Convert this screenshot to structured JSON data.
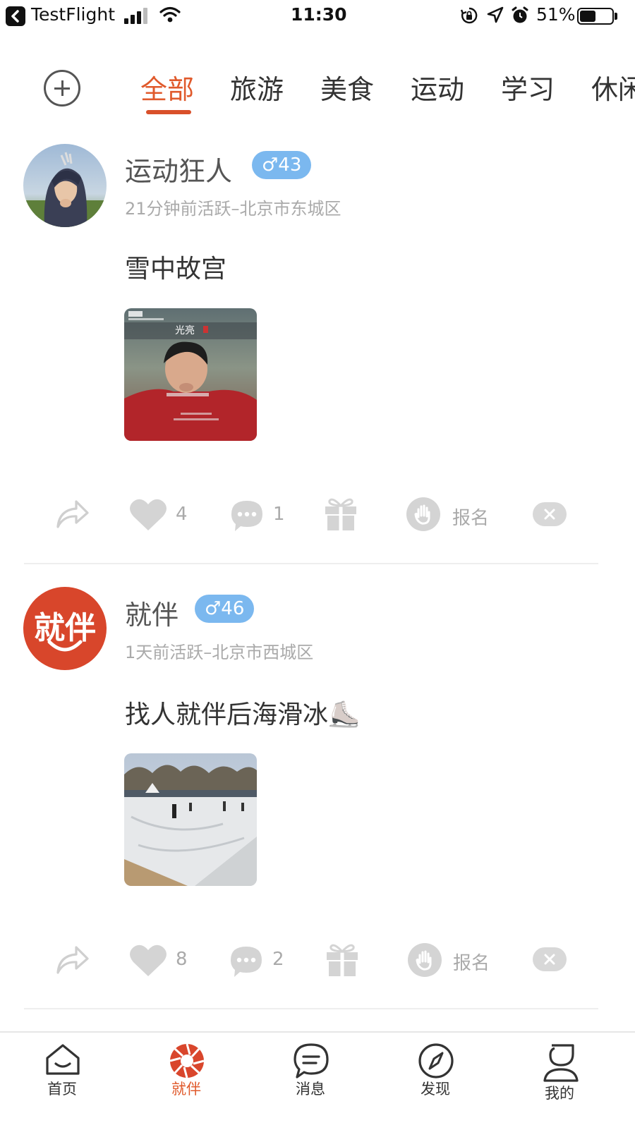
{
  "status_bar": {
    "app": "TestFlight",
    "time": "11:30",
    "battery": "51%",
    "battery_level": 0.51
  },
  "category_tabs": {
    "items": [
      "全部",
      "旅游",
      "美食",
      "运动",
      "学习",
      "休闲"
    ],
    "active": "全部"
  },
  "posts": [
    {
      "username": "运动狂人",
      "gender_badge": "♂43",
      "meta": "21分钟前活跃–北京市东城区",
      "text": "雪中故宫",
      "likes": "4",
      "comments": "1",
      "signup_label": "报名",
      "image_caption": "光亮"
    },
    {
      "username": "就伴",
      "gender_badge": "♂46",
      "meta": "1天前活跃–北京市西城区",
      "text": "找人就伴后海滑冰⛸️",
      "likes": "8",
      "comments": "2",
      "signup_label": "报名",
      "logo_text": "就伴"
    }
  ],
  "bottom_nav": {
    "items": [
      "首页",
      "就伴",
      "消息",
      "发现",
      "我的"
    ],
    "active": "就伴"
  },
  "colors": {
    "accent": "#e05a2c",
    "badge": "#7bb8ef",
    "muted": "#aaaaaa"
  }
}
